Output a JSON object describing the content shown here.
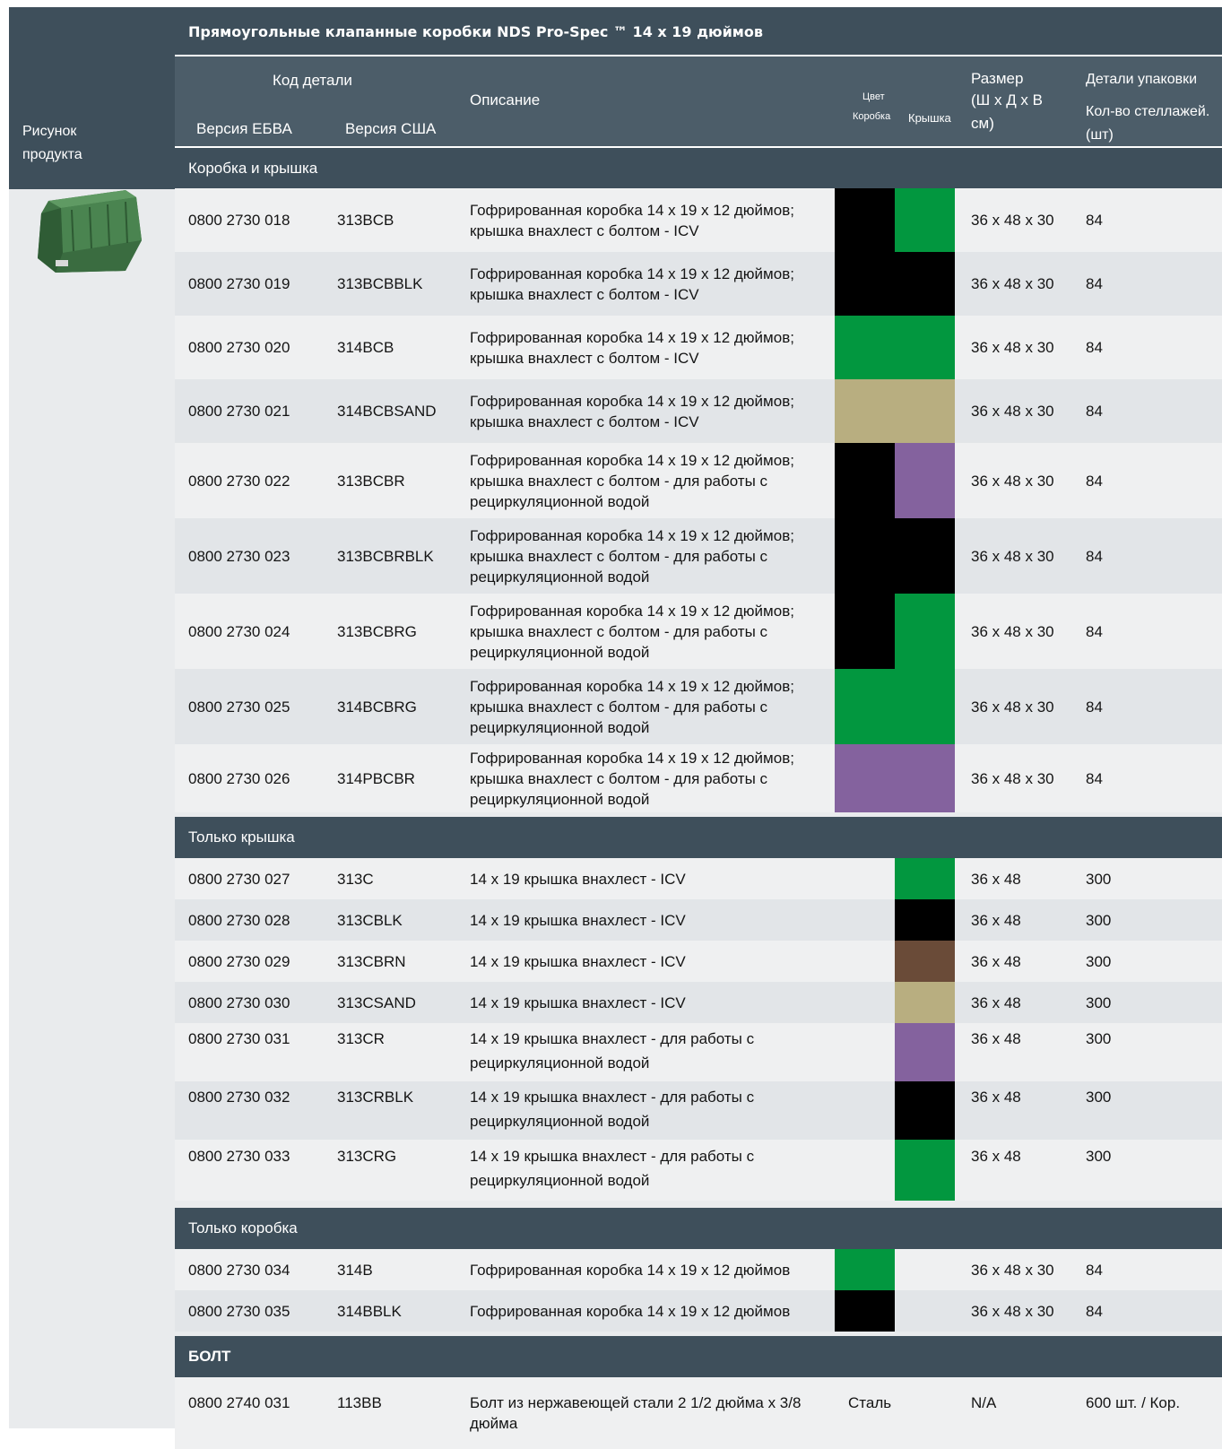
{
  "title": "Прямоугольные клапанные коробки NDS Pro-Spec ™ 14 x 19 дюймов",
  "headers": {
    "product_picture": [
      "Рисунок",
      "продукта"
    ],
    "part_code": "Код детали",
    "ebva_version": "Версия ЕБВА",
    "usa_version": "Версия США",
    "description": "Описание",
    "color": "Цвет",
    "box": "Коробка",
    "lid": "Крышка",
    "size": [
      "Размер",
      "(Ш x Д x В",
      "см)"
    ],
    "packaging": "Детали упаковки",
    "racks_qty": [
      "Кол-во стеллажей.",
      "(шт)"
    ]
  },
  "colors": {
    "black": "#000000",
    "green": "#02973f",
    "sand": "#b8ae80",
    "purple": "#84629e",
    "brown": "#6a4b38",
    "header_dark": "#3e4f5b",
    "header_mid": "#4c5d69"
  },
  "sections": [
    {
      "name": "Коробка и крышка",
      "rows": [
        {
          "ebva": "0800 2730 018",
          "usa": "313BCB",
          "desc": [
            "Гофрированная коробка 14 x 19 x 12 дюймов;",
            "крышка внахлест с болтом - ICV"
          ],
          "box": "black",
          "lid": "green",
          "size": "36 x 48 x 30",
          "qty": "84"
        },
        {
          "ebva": "0800 2730 019",
          "usa": "313BCBBLK",
          "desc": [
            "Гофрированная коробка 14 x 19 x 12 дюймов;",
            "крышка внахлест с болтом - ICV"
          ],
          "box": "black",
          "lid": "black",
          "size": "36 x 48 x 30",
          "qty": "84"
        },
        {
          "ebva": "0800 2730 020",
          "usa": "314BCB",
          "desc": [
            "Гофрированная коробка 14 x 19 x 12 дюймов;",
            "крышка внахлест с болтом - ICV"
          ],
          "box": "green",
          "lid": "green",
          "size": "36 x 48 x 30",
          "qty": "84"
        },
        {
          "ebva": "0800 2730 021",
          "usa": "314BCBSAND",
          "desc": [
            "Гофрированная коробка 14 x 19 x 12 дюймов;",
            "крышка внахлест с болтом - ICV"
          ],
          "box": "sand",
          "lid": "sand",
          "size": "36 x 48 x 30",
          "qty": "84"
        },
        {
          "ebva": "0800 2730 022",
          "usa": "313BCBR",
          "desc": [
            "Гофрированная коробка 14 x 19 x 12 дюймов;",
            "крышка внахлест с болтом - для работы с",
            "рециркуляционной водой"
          ],
          "box": "black",
          "lid": "purple",
          "size": "36 x 48 x 30",
          "qty": "84"
        },
        {
          "ebva": "0800 2730 023",
          "usa": "313BCBRBLK",
          "desc": [
            "Гофрированная коробка 14 x 19 x 12 дюймов;",
            "крышка внахлест с болтом - для работы с",
            "рециркуляционной водой"
          ],
          "box": "black",
          "lid": "black",
          "size": "36 x 48 x 30",
          "qty": "84"
        },
        {
          "ebva": "0800 2730 024",
          "usa": "313BCBRG",
          "desc": [
            "Гофрированная коробка 14 x 19 x 12 дюймов;",
            "крышка внахлест с болтом - для работы с",
            "рециркуляционной водой"
          ],
          "box": "black",
          "lid": "green",
          "size": "36 x 48 x 30",
          "qty": "84"
        },
        {
          "ebva": "0800 2730 025",
          "usa": "314BCBRG",
          "desc": [
            "Гофрированная коробка 14 x 19 x 12 дюймов;",
            "крышка внахлест с болтом - для работы с",
            "рециркуляционной водой"
          ],
          "box": "green",
          "lid": "green",
          "size": "36 x 48 x 30",
          "qty": "84"
        },
        {
          "ebva": "0800 2730 026",
          "usa": "314PBCBR",
          "desc": [
            "Гофрированная коробка 14 x 19 x 12 дюймов;",
            "крышка внахлест с болтом - для работы с",
            "рециркуляционной водой"
          ],
          "box": "purple",
          "lid": "purple",
          "size": "36 x 48 x 30",
          "qty": "84"
        }
      ]
    },
    {
      "name": "Только крышка",
      "rows": [
        {
          "ebva": "0800 2730 027",
          "usa": "313C",
          "desc": [
            "14 x 19 крышка внахлест - ICV"
          ],
          "box": "",
          "lid": "green",
          "size": "36 x 48",
          "qty": "300"
        },
        {
          "ebva": "0800 2730 028",
          "usa": "313CBLK",
          "desc": [
            "14 x 19 крышка внахлест - ICV"
          ],
          "box": "",
          "lid": "black",
          "size": "36 x 48",
          "qty": "300"
        },
        {
          "ebva": "0800 2730 029",
          "usa": "313CBRN",
          "desc": [
            "14 x 19 крышка внахлест - ICV"
          ],
          "box": "",
          "lid": "brown",
          "size": "36 x 48",
          "qty": "300"
        },
        {
          "ebva": "0800 2730 030",
          "usa": "313CSAND",
          "desc": [
            "14 x 19 крышка внахлест - ICV"
          ],
          "box": "",
          "lid": "sand",
          "size": "36 x 48",
          "qty": "300"
        },
        {
          "ebva": "0800 2730 031",
          "usa": "313CR",
          "desc": [
            "14 x 19 крышка внахлест - для работы с",
            "рециркуляционной водой"
          ],
          "box": "",
          "lid": "purple",
          "size": "36 x 48",
          "qty": "300"
        },
        {
          "ebva": "0800 2730 032",
          "usa": "313CRBLK",
          "desc": [
            "14 x 19 крышка внахлест - для работы с",
            "рециркуляционной водой"
          ],
          "box": "",
          "lid": "black",
          "size": "36 x 48",
          "qty": "300"
        },
        {
          "ebva": "0800 2730 033",
          "usa": "313CRG",
          "desc": [
            "14 x 19 крышка внахлест - для работы с",
            "рециркуляционной водой"
          ],
          "box": "",
          "lid": "green",
          "size": "36 x 48",
          "qty": "300"
        }
      ]
    },
    {
      "name": "Только коробка",
      "rows": [
        {
          "ebva": "0800 2730 034",
          "usa": "314B",
          "desc": [
            "Гофрированная коробка 14 x 19 x 12 дюймов"
          ],
          "box": "green",
          "lid": "",
          "size": "36 x 48 x 30",
          "qty": "84"
        },
        {
          "ebva": "0800 2730 035",
          "usa": "314BBLK",
          "desc": [
            "Гофрированная коробка 14 x 19 x 12 дюймов"
          ],
          "box": "black",
          "lid": "",
          "size": "36 x 48 x 30",
          "qty": "84"
        }
      ]
    },
    {
      "name": "БОЛТ",
      "rows": [
        {
          "ebva": "0800 2740 031",
          "usa": "113BB",
          "desc": [
            "Болт из нержавеющей стали 2 1/2 дюйма x 3/8",
            "дюйма"
          ],
          "box": "",
          "lid": "",
          "color_text": "Сталь",
          "size": "N/A",
          "qty": "600 шт. / Кор."
        }
      ]
    }
  ]
}
